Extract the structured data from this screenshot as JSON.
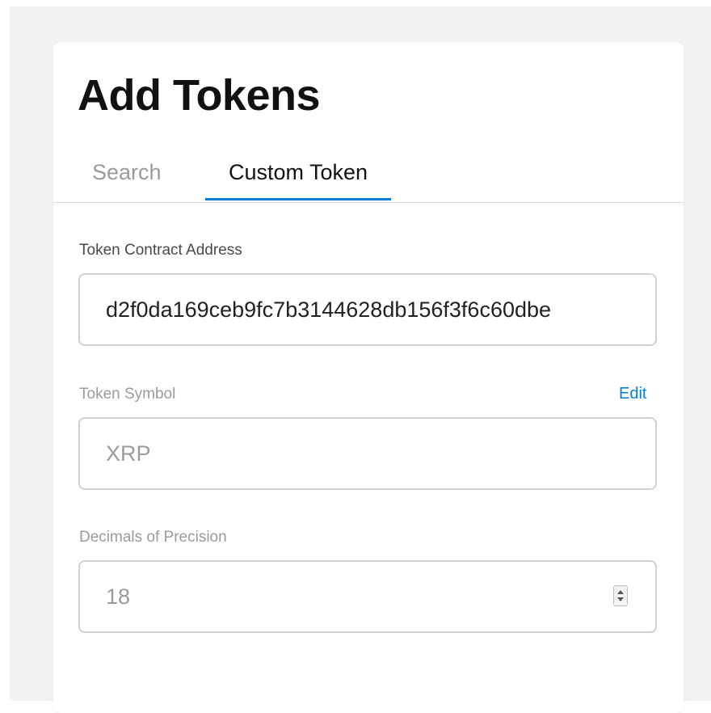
{
  "page": {
    "title": "Add Tokens"
  },
  "tabs": [
    {
      "label": "Search",
      "active": false
    },
    {
      "label": "Custom Token",
      "active": true
    }
  ],
  "form": {
    "address": {
      "label": "Token Contract Address",
      "value": "d2f0da169ceb9fc7b3144628db156f3f6c60dbe"
    },
    "symbol": {
      "label": "Token Symbol",
      "value": "XRP",
      "edit_label": "Edit"
    },
    "decimals": {
      "label": "Decimals of Precision",
      "value": "18"
    }
  },
  "colors": {
    "accent": "#037dd6",
    "muted_text": "#9b9b9b",
    "border": "#cdd1d5",
    "background": "#f2f2f2"
  },
  "icons": {
    "stepper": "number-stepper-icon"
  }
}
